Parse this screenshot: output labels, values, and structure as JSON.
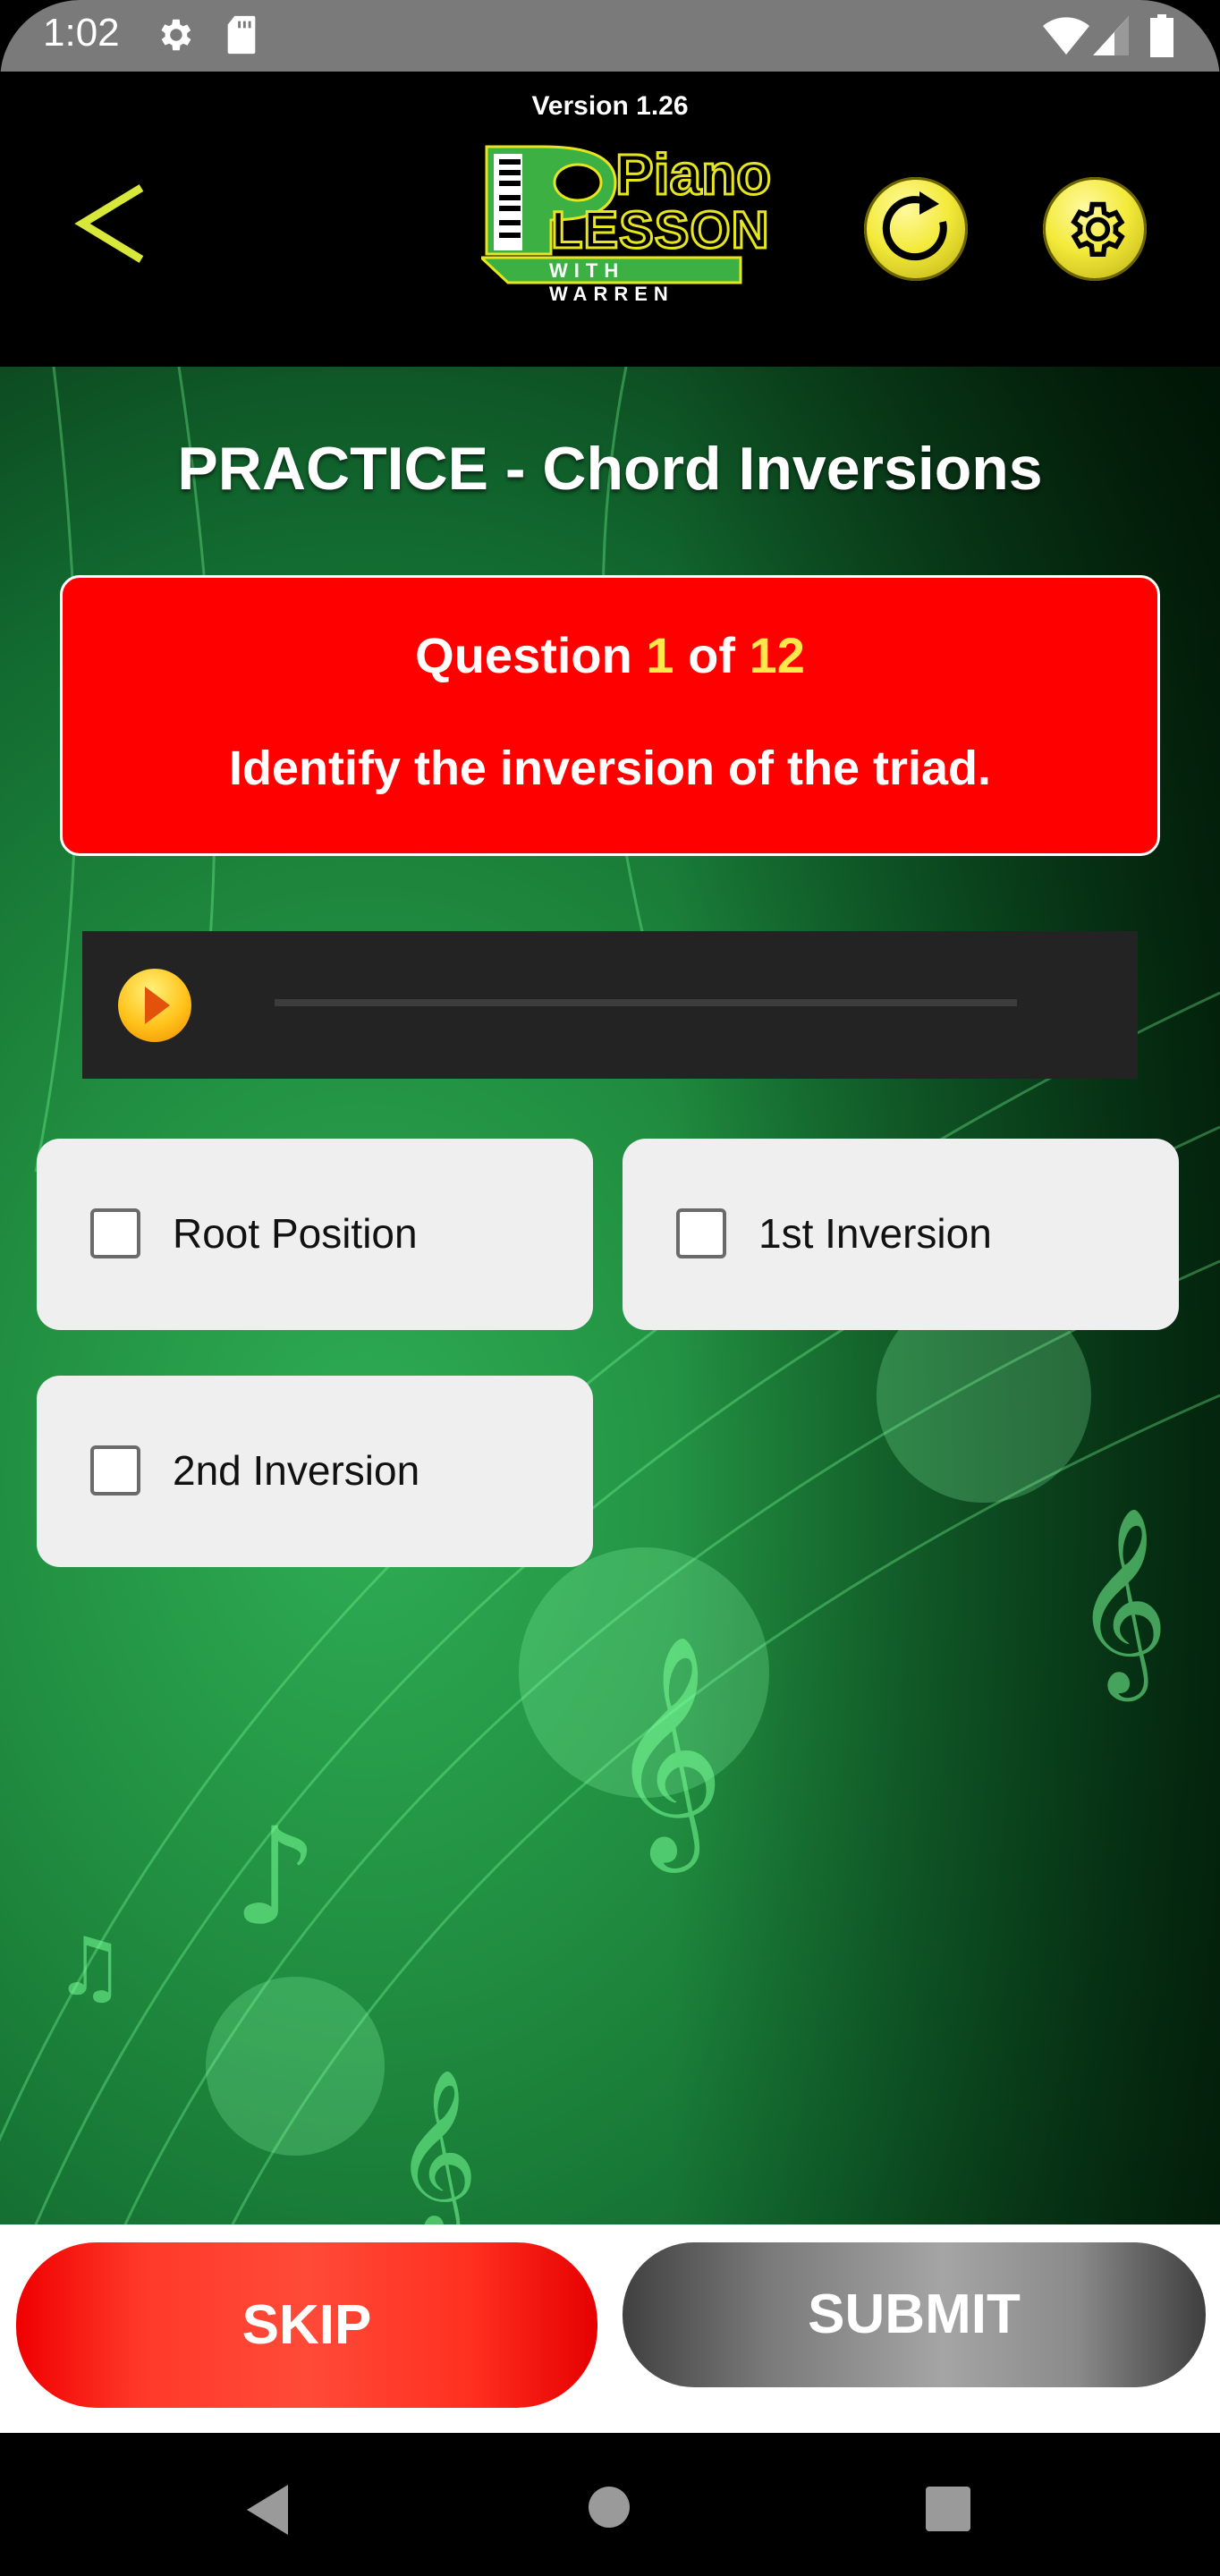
{
  "status_bar": {
    "time": "1:02",
    "left_icons": [
      "settings-icon",
      "sd-card-icon"
    ],
    "right_icons": [
      "wifi-icon",
      "signal-icon",
      "battery-icon"
    ]
  },
  "header": {
    "version": "Version 1.26",
    "logo": {
      "line1": "Piano",
      "line2": "LESSON",
      "line3": "WITH WARREN"
    },
    "back_icon": "chevron-left-icon",
    "refresh_icon": "refresh-icon",
    "settings_icon": "gear-icon"
  },
  "practice": {
    "title": "PRACTICE - Chord Inversions",
    "question": {
      "prefix": "Question",
      "current": "1",
      "of": "of",
      "total": "12"
    },
    "prompt": "Identify the inversion of the triad.",
    "audio": {
      "play_icon": "play-icon",
      "progress": 0
    },
    "options": [
      {
        "label": "Root Position",
        "checked": false
      },
      {
        "label": "1st Inversion",
        "checked": false
      },
      {
        "label": "2nd Inversion",
        "checked": false
      }
    ]
  },
  "actions": {
    "skip": "SKIP",
    "submit": "SUBMIT"
  },
  "colors": {
    "accent_yellow": "#ffe94a",
    "question_red": "#ff0000",
    "logo_green": "#3cb043",
    "logo_yellow": "#e6e61e"
  }
}
